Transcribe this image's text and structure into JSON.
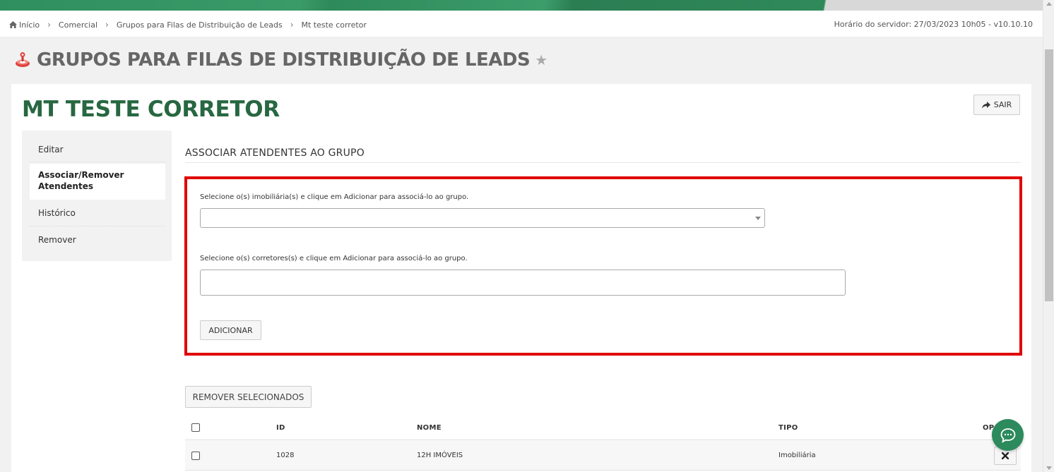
{
  "breadcrumb": {
    "items": [
      "Início",
      "Comercial",
      "Grupos para Filas de Distribuição de Leads",
      "Mt teste corretor"
    ],
    "server_time": "Horário do servidor: 27/03/2023 10h05 - v10.10.10"
  },
  "header": {
    "title": "GRUPOS PARA FILAS DE DISTRIBUIÇÃO DE LEADS"
  },
  "entity": {
    "title": "MT TESTE CORRETOR",
    "exit_label": "SAIR"
  },
  "side_menu": {
    "items": [
      {
        "label": "Editar"
      },
      {
        "label": "Associar/Remover Atendentes"
      },
      {
        "label": "Histórico"
      },
      {
        "label": "Remover"
      }
    ]
  },
  "section": {
    "title": "ASSOCIAR ATENDENTES AO GRUPO"
  },
  "form": {
    "agencies_help": "Selecione o(s) imobiliária(s) e clique em Adicionar para associá-lo ao grupo.",
    "agencies_value": "",
    "brokers_help": "Selecione o(s) corretores(s) e clique em Adicionar para associá-lo ao grupo.",
    "brokers_value": "",
    "add_label": "ADICIONAR"
  },
  "table": {
    "remove_selected_label": "REMOVER SELECIONADOS",
    "columns": [
      "ID",
      "NOME",
      "TIPO",
      "OP"
    ],
    "rows": [
      {
        "id": "1028",
        "name": "12H IMÓVEIS",
        "type": "Imobiliária"
      }
    ]
  },
  "colors": {
    "brand_green": "#276741",
    "highlight_red": "#e00000",
    "chat_green": "#2c8a5c"
  },
  "icons": {
    "home": "home-icon",
    "header": "leads-distribution-icon",
    "favorite": "star-icon",
    "exit": "share-arrow-icon",
    "dropdown": "chevron-down-icon",
    "delete": "close-icon",
    "chat": "chat-bubble-icon"
  }
}
